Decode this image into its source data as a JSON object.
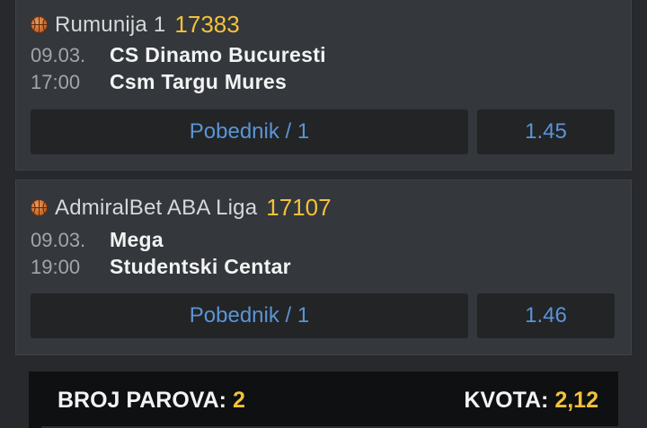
{
  "tickets": [
    {
      "league": "Rumunija 1",
      "code": "17383",
      "date": "09.03.",
      "time": "17:00",
      "home": "CS Dinamo Bucuresti",
      "away": "Csm Targu Mures",
      "bet": "Pobednik / 1",
      "odd": "1.45"
    },
    {
      "league": "AdmiralBet ABA Liga",
      "code": "17107",
      "date": "09.03.",
      "time": "19:00",
      "home": "Mega",
      "away": "Studentski Centar",
      "bet": "Pobednik / 1",
      "odd": "1.46"
    }
  ],
  "summary": {
    "pairs_label": "BROJ PAROVA:",
    "pairs_value": "2",
    "odds_label": "KVOTA:",
    "odds_value": "2,12"
  },
  "icons": {
    "sport": "basketball-icon"
  },
  "colors": {
    "accent_yellow": "#f3c23a",
    "link_blue": "#5b94d6",
    "card_bg": "#34373b"
  }
}
